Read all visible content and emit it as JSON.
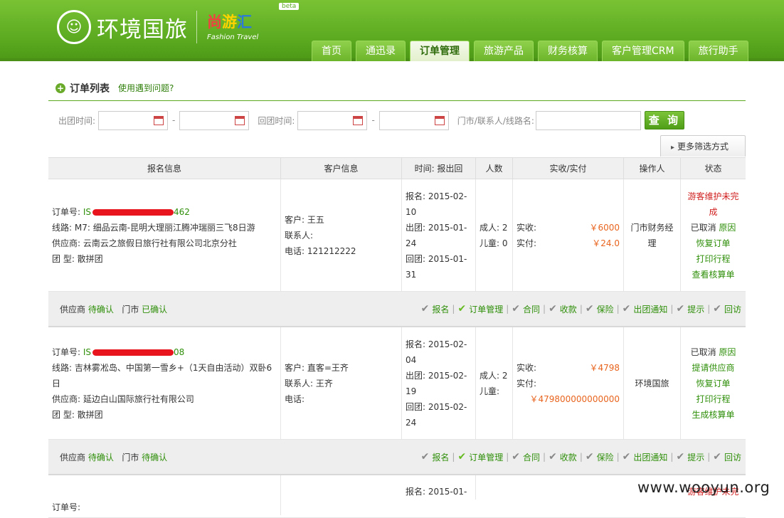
{
  "brand": {
    "name": "环境国旅",
    "circle_glyph": "☺",
    "fashion_cn": [
      "尚",
      "游",
      "汇"
    ],
    "fashion_en": "Fashion Travel",
    "beta": "beta"
  },
  "nav": [
    {
      "label": "首页",
      "active": false
    },
    {
      "label": "通迅录",
      "active": false
    },
    {
      "label": "订单管理",
      "active": true
    },
    {
      "label": "旅游产品",
      "active": false
    },
    {
      "label": "财务核算",
      "active": false
    },
    {
      "label": "客户管理CRM",
      "active": false
    },
    {
      "label": "旅行助手",
      "active": false
    }
  ],
  "page": {
    "title": "订单列表",
    "help": "使用遇到问题?"
  },
  "filters": {
    "depart_label": "出团时间:",
    "return_label": "回团时间:",
    "dash": "-",
    "keyword_label": "门市/联系人/线路名:",
    "query_button": "查 询",
    "more_button": "更多筛选方式"
  },
  "columns": [
    "报名信息",
    "客户信息",
    "时间: 报出回",
    "人数",
    "实收/实付",
    "操作人",
    "状态"
  ],
  "orders": [
    {
      "order_label": "订单号:",
      "order_prefix": "IS",
      "order_suffix": "462",
      "route": "线路: M7: 细品云南-昆明大理丽江腾冲瑞丽三飞8日游",
      "supplier": "供应商: 云南云之旅假日旅行社有限公司北京分社",
      "type": "团 型: 散拼团",
      "customer": "客户: 王五",
      "contact": "联系人:",
      "phone": "电话: 121212222",
      "signup": "报名: 2015-02-10",
      "depart": "出团: 2015-01-24",
      "return": "回团: 2015-01-31",
      "adult": "成人: 2",
      "child": "儿童: 0",
      "received_label": "实收:",
      "received": "￥6000",
      "paid_label": "实付:",
      "paid": "￥24.0",
      "operator": "门市财务经理",
      "status": [
        {
          "text": "游客维护未完成",
          "color": "red"
        },
        {
          "text": "已取消",
          "color": "dark",
          "link": "原因"
        },
        {
          "text": "恢复订单",
          "color": "green"
        },
        {
          "text": "打印行程",
          "color": "green"
        },
        {
          "text": "查看核算单",
          "color": "green"
        }
      ],
      "confirm": {
        "supplier_label": "供应商",
        "supplier_state": "待确认",
        "shop_label": "门市",
        "shop_state": "已确认"
      }
    },
    {
      "order_label": "订单号:",
      "order_prefix": "IS",
      "order_suffix": "08",
      "route": "线路: 吉林雾凇岛、中国第一雪乡+（1天自由活动）双卧6日",
      "supplier": "供应商: 延边白山国际旅行社有限公司",
      "type": "团 型: 散拼团",
      "customer": "客户: 直客=王齐",
      "contact": "联系人: 王齐",
      "phone": "电话:",
      "signup": "报名: 2015-02-04",
      "depart": "出团: 2015-02-19",
      "return": "回团: 2015-02-24",
      "adult": "成人: 2",
      "child": "儿童:",
      "received_label": "实收:",
      "received": "￥4798",
      "paid_label": "实付:",
      "paid": "￥479800000000000",
      "operator": "环境国旅",
      "status": [
        {
          "text": "已取消",
          "color": "dark",
          "link": "原因"
        },
        {
          "text": "提请供应商",
          "color": "green"
        },
        {
          "text": "恢复订单",
          "color": "green"
        },
        {
          "text": "打印行程",
          "color": "green"
        },
        {
          "text": "生成核算单",
          "color": "green"
        }
      ],
      "confirm": {
        "supplier_label": "供应商",
        "supplier_state": "待确认",
        "shop_label": "门市",
        "shop_state": "待确认"
      }
    }
  ],
  "steps": [
    "报名",
    "订单管理",
    "合同",
    "收款",
    "保险",
    "出团通知",
    "提示",
    "回访"
  ],
  "partial_row": {
    "order_label": "订单号:",
    "signup": "报名: 2015-01-",
    "status": "游客维护未完"
  },
  "watermark": "www.wooyun.org"
}
